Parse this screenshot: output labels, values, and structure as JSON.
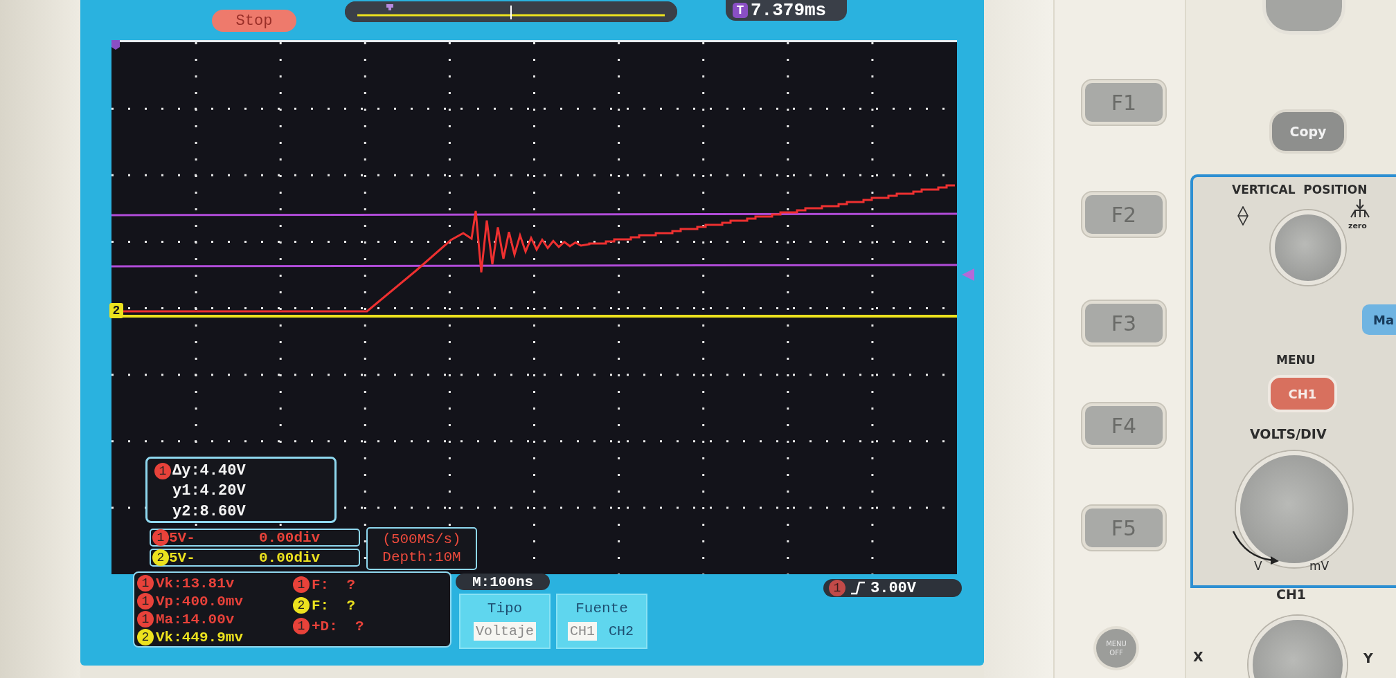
{
  "status": {
    "run_state": "Stop",
    "trigger_badge": "T",
    "trigger_time": "7.379ms"
  },
  "ground_marker": "2",
  "cursor_readout": {
    "badge": "1",
    "color": "#e8423a",
    "lines": [
      "Δy:4.40V",
      "y1:4.20V",
      "y2:8.60V"
    ]
  },
  "channels": [
    {
      "badge": "1",
      "scale": "5V-",
      "offset": "0.00div",
      "color": "#e8423a"
    },
    {
      "badge": "2",
      "scale": "5V-",
      "offset": "0.00div",
      "color": "#ece21e"
    }
  ],
  "acquisition": {
    "sample_rate": "(500MS/s)",
    "depth": "Depth:10M"
  },
  "measurements": {
    "left": [
      {
        "badge": "1",
        "text": "Vk:13.81v",
        "color": "#e8423a"
      },
      {
        "badge": "1",
        "text": "Vp:400.0mv",
        "color": "#e8423a"
      },
      {
        "badge": "1",
        "text": "Ma:14.00v",
        "color": "#e8423a"
      },
      {
        "badge": "2",
        "text": "Vk:449.9mv",
        "color": "#ece21e"
      }
    ],
    "right": [
      {
        "badge": "1",
        "text": "F:  ?",
        "color": "#e8423a"
      },
      {
        "badge": "2",
        "text": "F:  ?",
        "color": "#ece21e"
      },
      {
        "badge": "1",
        "text": "+D:  ?",
        "color": "#e8423a"
      }
    ]
  },
  "timebase": "M:100ns",
  "trigger": {
    "badge": "1",
    "level": "3.00V"
  },
  "menu": [
    {
      "title": "Tipo",
      "options": [
        {
          "label": "Voltaje",
          "selected": true
        }
      ]
    },
    {
      "title": "Fuente",
      "options": [
        {
          "label": "CH1",
          "selected": true
        },
        {
          "label": "CH2",
          "selected": false
        }
      ]
    }
  ],
  "soft_keys": [
    "F1",
    "F2",
    "F3",
    "F4",
    "F5"
  ],
  "menu_off": "MENU OFF",
  "panel": {
    "copy": "Copy",
    "vertical_title": "VERTICAL  POSITION",
    "zero_label": "zero",
    "menu_label": "MENU",
    "ch1_button": "CH1",
    "volts_label": "VOLTS/DIV",
    "v_label": "V",
    "mv_label": "mV",
    "math_button": "Ma",
    "channel_label": "CH1",
    "x_label": "X",
    "y_label": "Y"
  }
}
